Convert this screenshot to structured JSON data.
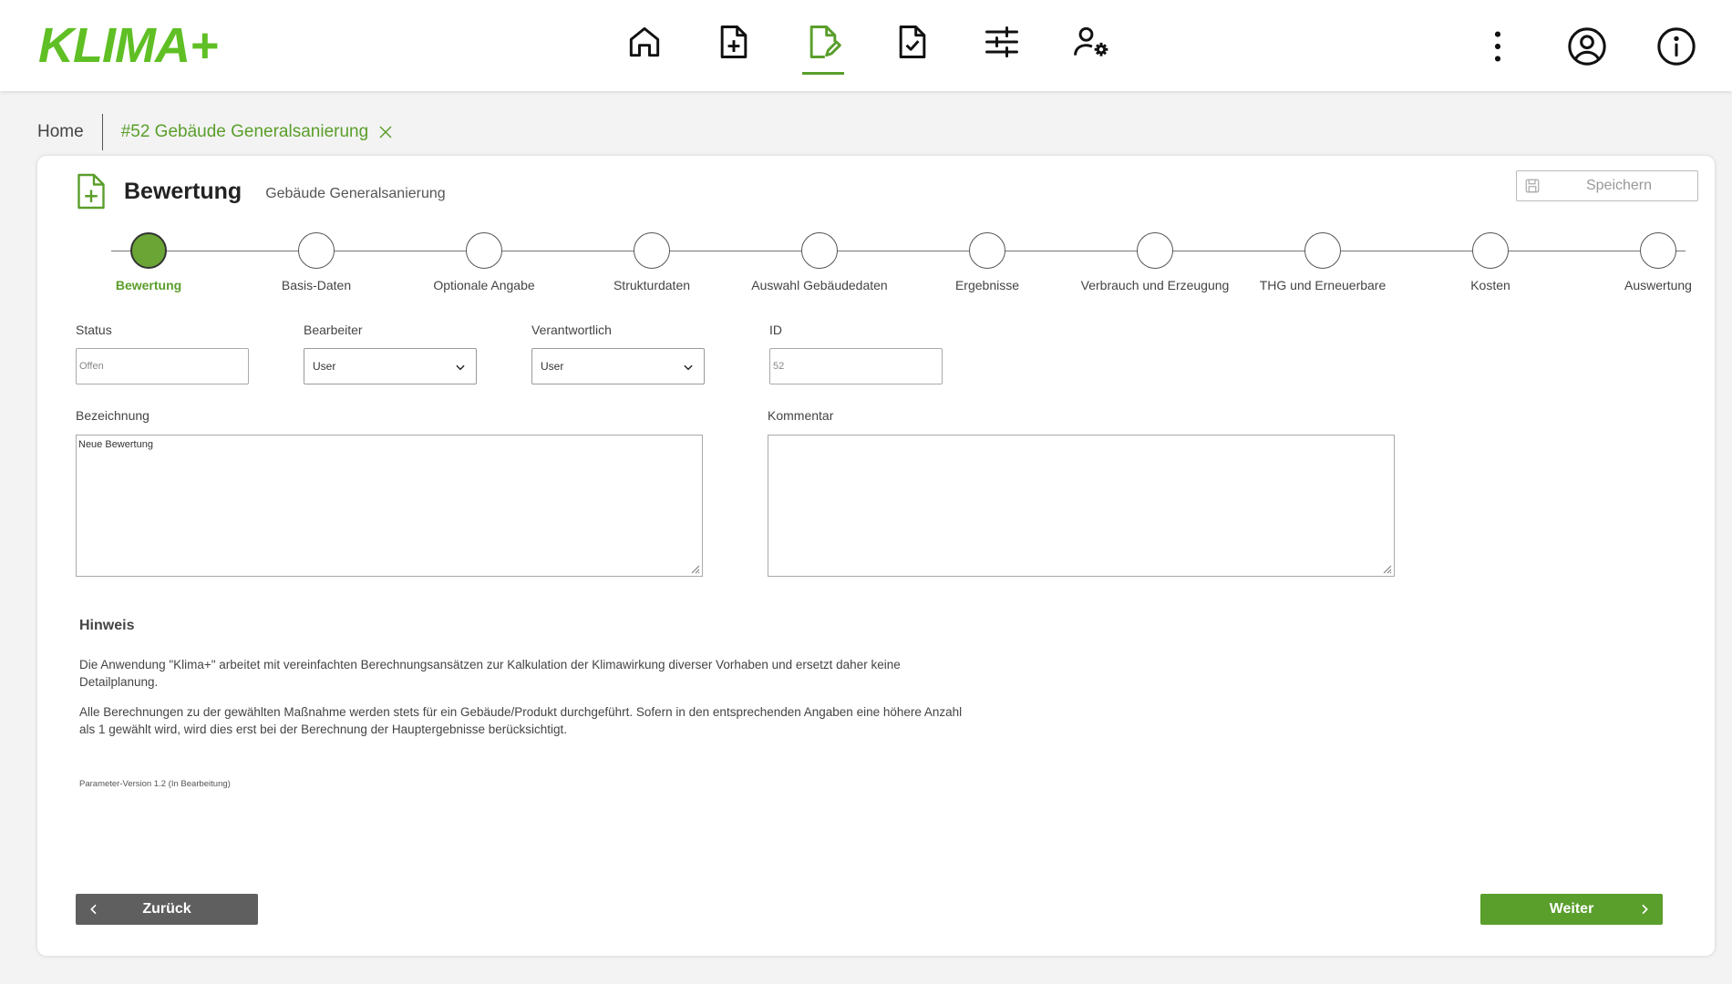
{
  "brand": {
    "name": "KLIMA+",
    "color": "#5fbf24",
    "accent": "#5a9e2b"
  },
  "nav": {
    "icons": [
      "home-icon",
      "file-plus-icon",
      "file-edit-icon",
      "file-check-icon",
      "sliders-icon",
      "user-settings-icon"
    ],
    "active": "file-edit-icon",
    "right_icons": [
      "more-vertical-icon",
      "account-icon",
      "info-icon"
    ]
  },
  "breadcrumb": {
    "home": "Home",
    "current": "#52 Gebäude Generalsanierung"
  },
  "card": {
    "title": "Bewertung",
    "subtitle": "Gebäude Generalsanierung",
    "save_label": "Speichern"
  },
  "stepper": {
    "steps": [
      "Bewertung",
      "Basis-Daten",
      "Optionale Angabe",
      "Strukturdaten",
      "Auswahl Gebäudedaten",
      "Ergebnisse",
      "Verbrauch und Erzeugung",
      "THG und Erneuerbare",
      "Kosten",
      "Auswertung"
    ],
    "active_index": 0
  },
  "form": {
    "status_label": "Status",
    "status_value": "Offen",
    "bearbeiter_label": "Bearbeiter",
    "bearbeiter_value": "User",
    "verantwortlich_label": "Verantwortlich",
    "verantwortlich_value": "User",
    "id_label": "ID",
    "id_value": "52",
    "bezeichnung_label": "Bezeichnung",
    "bezeichnung_value": "Neue Bewertung",
    "kommentar_label": "Kommentar",
    "kommentar_value": ""
  },
  "hint": {
    "title": "Hinweis",
    "p1": "Die Anwendung \"Klima+\" arbeitet mit vereinfachten Berechnungsansätzen zur Kalkulation der Klimawirkung diverser Vorhaben und ersetzt daher keine Detailplanung.",
    "p2": "Alle Berechnungen zu der gewählten Maßnahme werden stets für ein Gebäude/Produkt durchgeführt. Sofern in den entsprechenden Angaben eine höhere Anzahl als 1 gewählt wird, wird dies erst bei der Berechnung der Hauptergebnisse berücksichtigt.",
    "param_version": "Parameter-Version 1.2 (In Bearbeitung)"
  },
  "buttons": {
    "back": "Zurück",
    "next": "Weiter"
  }
}
